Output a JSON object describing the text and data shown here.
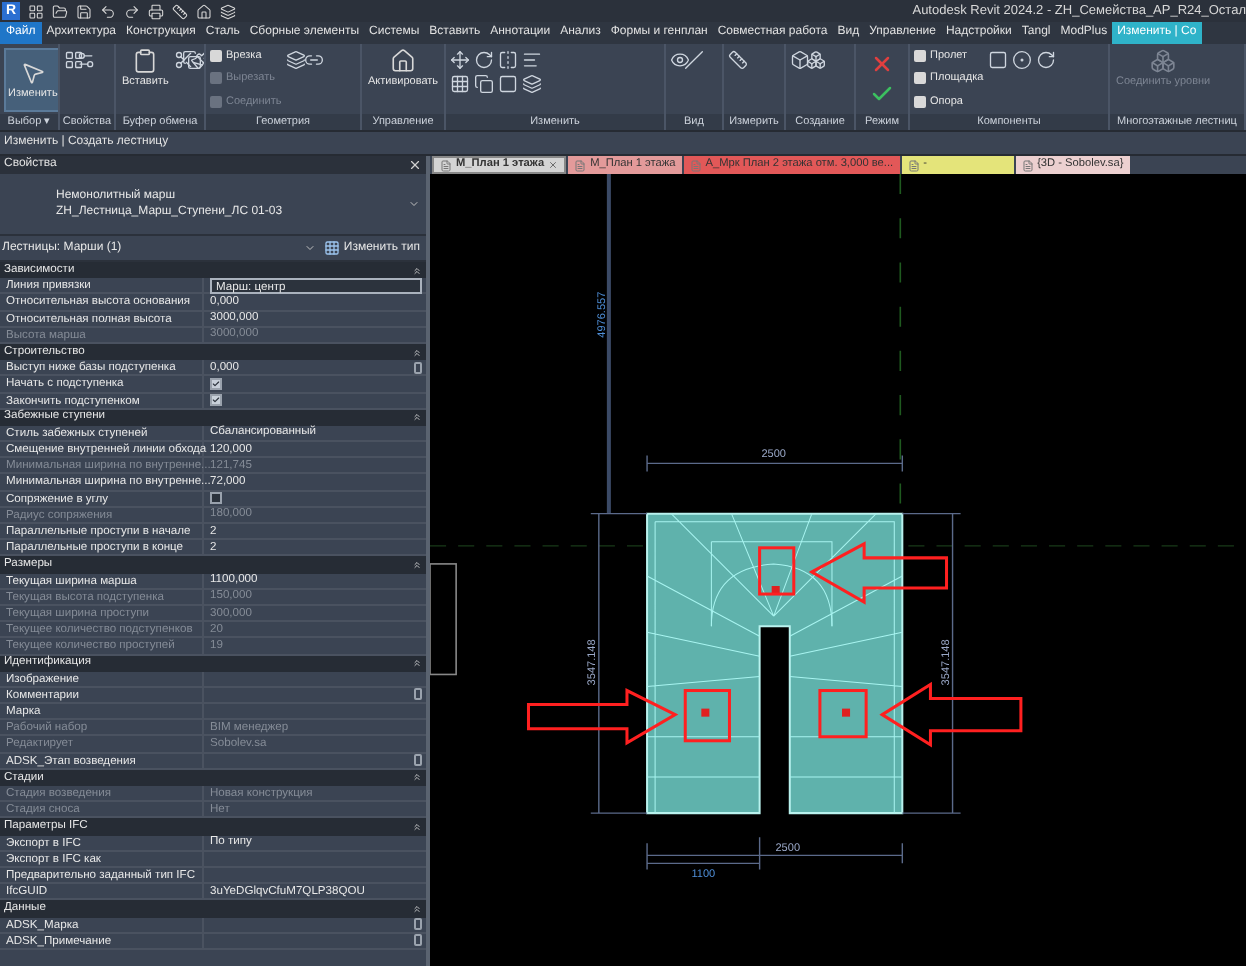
{
  "title_bar": {
    "logo": "R",
    "title": "Autodesk Revit 2024.2 - ZH_Семейства_АР_R24_Остал"
  },
  "file_menu": {
    "label": "Файл"
  },
  "ribbon_tabs": [
    {
      "label": "Архитектура",
      "selected": false
    },
    {
      "label": "Конструкция",
      "selected": false
    },
    {
      "label": "Сталь",
      "selected": false
    },
    {
      "label": "Сборные элементы",
      "selected": false
    },
    {
      "label": "Системы",
      "selected": false
    },
    {
      "label": "Вставить",
      "selected": false
    },
    {
      "label": "Аннотации",
      "selected": false
    },
    {
      "label": "Анализ",
      "selected": false
    },
    {
      "label": "Формы и генплан",
      "selected": false
    },
    {
      "label": "Совместная работа",
      "selected": false
    },
    {
      "label": "Вид",
      "selected": false
    },
    {
      "label": "Управление",
      "selected": false
    },
    {
      "label": "Надстройки",
      "selected": false
    },
    {
      "label": "Tangl",
      "selected": false
    },
    {
      "label": "ModPlus",
      "selected": false
    },
    {
      "label": "Изменить | Со",
      "selected": true
    }
  ],
  "ribbon_panels": [
    {
      "label": "Выбор ▾",
      "buttons": [
        {
          "label": "Изменить",
          "kind": "large",
          "disabled": false
        }
      ]
    },
    {
      "label": "Свойства"
    },
    {
      "label": "Буфер обмена",
      "buttons": [
        {
          "label": "Вставить",
          "kind": "large",
          "disabled": false
        }
      ]
    },
    {
      "label": "Геометрия",
      "buttons": [
        {
          "label": "Врезка",
          "kind": "small",
          "disabled": false
        },
        {
          "label": "Вырезать",
          "kind": "small",
          "disabled": true
        },
        {
          "label": "Соединить",
          "kind": "small",
          "disabled": true
        }
      ]
    },
    {
      "label": "Управление",
      "buttons": [
        {
          "label": "Активировать",
          "kind": "large",
          "disabled": false
        }
      ]
    },
    {
      "label": "Изменить"
    },
    {
      "label": "Вид"
    },
    {
      "label": "Измерить"
    },
    {
      "label": "Создание"
    },
    {
      "label": "Режим"
    },
    {
      "label": "Компоненты",
      "buttons": [
        {
          "label": "Пролет",
          "kind": "small",
          "disabled": false
        },
        {
          "label": "Площадка",
          "kind": "small",
          "disabled": false
        },
        {
          "label": "Опора",
          "kind": "small",
          "disabled": false
        }
      ]
    },
    {
      "label": "Многоэтажные лестниц",
      "buttons": [
        {
          "label": "Соединить уровни",
          "kind": "large",
          "disabled": true
        }
      ]
    }
  ],
  "options_bar": {
    "text": "Изменить | Создать лестницу"
  },
  "properties": {
    "title": "Свойства",
    "type_name": "Немонолитный марш",
    "type_family": "ZH_Лестница_Марш_Ступени_ЛС 01-03",
    "instance_filter": "Лестницы: Марши (1)",
    "edit_type": "Изменить тип",
    "groups": [
      {
        "name": "Зависимости",
        "rows": [
          {
            "label": "Линия привязки",
            "value": "Марш: центр",
            "kind": "field",
            "disabled": false,
            "edit_button": false
          },
          {
            "label": "Относительная высота основания",
            "value": "0,000",
            "kind": "text",
            "disabled": false,
            "edit_button": false
          },
          {
            "label": "Относительная полная высота",
            "value": "3000,000",
            "kind": "text",
            "disabled": false,
            "edit_button": false
          },
          {
            "label": "Высота марша",
            "value": "3000,000",
            "kind": "text",
            "disabled": true,
            "edit_button": false
          }
        ]
      },
      {
        "name": "Строительство",
        "rows": [
          {
            "label": "Выступ ниже базы подступенка",
            "value": "0,000",
            "kind": "text",
            "disabled": false,
            "edit_button": true
          },
          {
            "label": "Начать с подступенка",
            "kind": "checkbox",
            "checked": true,
            "disabled": false,
            "edit_button": false
          },
          {
            "label": "Закончить подступенком",
            "kind": "checkbox",
            "checked": true,
            "disabled": false,
            "edit_button": false
          }
        ]
      },
      {
        "name": "Забежные ступени",
        "rows": [
          {
            "label": "Стиль забежных ступеней",
            "value": "Сбалансированный",
            "kind": "text",
            "disabled": false,
            "edit_button": false
          },
          {
            "label": "Смещение внутренней линии обхода",
            "value": "120,000",
            "kind": "text",
            "disabled": false,
            "edit_button": false
          },
          {
            "label": "Минимальная ширина по внутренне...",
            "value": "121,745",
            "kind": "text",
            "disabled": true,
            "edit_button": false
          },
          {
            "label": "Минимальная ширина по внутренне...",
            "value": "72,000",
            "kind": "text",
            "disabled": false,
            "edit_button": false
          },
          {
            "label": "Сопряжение в углу",
            "kind": "checkbox",
            "checked": false,
            "disabled": false,
            "edit_button": false
          },
          {
            "label": "Радиус сопряжения",
            "value": "180,000",
            "kind": "text",
            "disabled": true,
            "edit_button": false
          },
          {
            "label": "Параллельные проступи в начале",
            "value": "2",
            "kind": "text",
            "disabled": false,
            "edit_button": false
          },
          {
            "label": "Параллельные проступи в конце",
            "value": "2",
            "kind": "text",
            "disabled": false,
            "edit_button": false
          }
        ]
      },
      {
        "name": "Размеры",
        "rows": [
          {
            "label": "Текущая ширина марша",
            "value": "1100,000",
            "kind": "text",
            "disabled": false,
            "edit_button": false
          },
          {
            "label": "Текущая высота подступенка",
            "value": "150,000",
            "kind": "text",
            "disabled": true,
            "edit_button": false
          },
          {
            "label": "Текущая ширина проступи",
            "value": "300,000",
            "kind": "text",
            "disabled": true,
            "edit_button": false
          },
          {
            "label": "Текущее количество подступенков",
            "value": "20",
            "kind": "text",
            "disabled": true,
            "edit_button": false
          },
          {
            "label": "Текущее количество проступей",
            "value": "19",
            "kind": "text",
            "disabled": true,
            "edit_button": false
          }
        ]
      },
      {
        "name": "Идентификация",
        "rows": [
          {
            "label": "Изображение",
            "kind": "text",
            "disabled": false,
            "edit_button": false
          },
          {
            "label": "Комментарии",
            "kind": "text",
            "disabled": false,
            "edit_button": true
          },
          {
            "label": "Марка",
            "kind": "text",
            "disabled": false,
            "edit_button": false
          },
          {
            "label": "Рабочий набор",
            "value": "BIM менеджер",
            "kind": "text",
            "disabled": true,
            "edit_button": false
          },
          {
            "label": "Редактирует",
            "value": "Sobolev.sa",
            "kind": "text",
            "disabled": true,
            "edit_button": false
          },
          {
            "label": "ADSK_Этап возведения",
            "kind": "text",
            "disabled": false,
            "edit_button": true
          }
        ]
      },
      {
        "name": "Стадии",
        "rows": [
          {
            "label": "Стадия возведения",
            "value": "Новая конструкция",
            "kind": "text",
            "disabled": true,
            "edit_button": false
          },
          {
            "label": "Стадия сноса",
            "value": "Нет",
            "kind": "text",
            "disabled": true,
            "edit_button": false
          }
        ]
      },
      {
        "name": "Параметры IFC",
        "rows": [
          {
            "label": "Экспорт в IFC",
            "value": "По типу",
            "kind": "text",
            "disabled": false,
            "edit_button": false
          },
          {
            "label": "Экспорт в IFC как",
            "kind": "text",
            "disabled": false,
            "edit_button": false
          },
          {
            "label": "Предварительно заданный тип IFC",
            "kind": "text",
            "disabled": false,
            "edit_button": false
          },
          {
            "label": "IfcGUID",
            "value": "3uYeDGlqvCfuM7QLP38QOU",
            "kind": "text",
            "disabled": false,
            "edit_button": false
          }
        ]
      },
      {
        "name": "Данные",
        "rows": [
          {
            "label": "ADSK_Марка",
            "kind": "text",
            "disabled": false,
            "edit_button": true
          },
          {
            "label": "ADSK_Примечание",
            "kind": "text",
            "disabled": false,
            "edit_button": true
          }
        ]
      }
    ]
  },
  "view_tabs": [
    {
      "label": "M_План 1 этажа",
      "selected": true,
      "color": "#d4d4d4"
    },
    {
      "label": "M_План 1 этажа",
      "selected": false,
      "color": "#e39a9a"
    },
    {
      "label": "A_Мрк План 2 этажа отм. 3,000 ве...",
      "selected": false,
      "color": "#e25858"
    },
    {
      "label": "-",
      "selected": false,
      "color": "#e4e47a"
    },
    {
      "label": "{3D - Sobolev.sa}",
      "selected": false,
      "color": "#ecd0d0"
    }
  ],
  "canvas": {
    "dimension_labels": [
      "4976.557",
      "2500",
      "3547.148",
      "3547.148",
      "2500",
      "1100"
    ]
  }
}
